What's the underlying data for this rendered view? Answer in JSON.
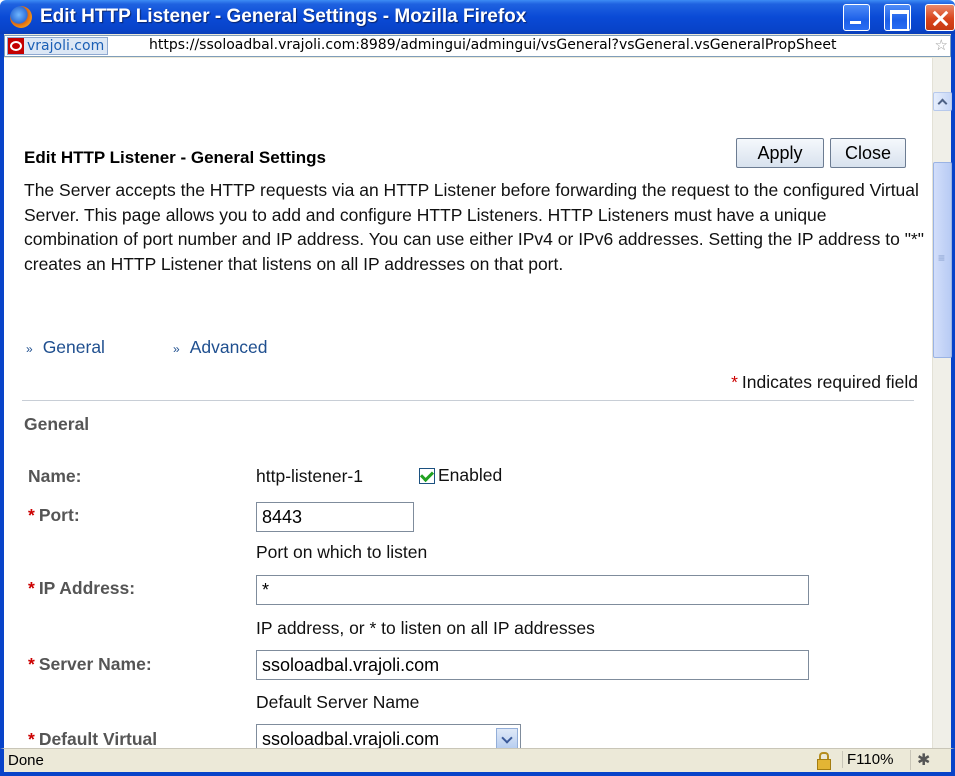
{
  "window": {
    "title": "Edit HTTP Listener - General Settings - Mozilla Firefox"
  },
  "urlbar": {
    "site_name": "vrajoli.com",
    "url": "https://ssoloadbal.vrajoli.com:8989/admingui/admingui/vsGeneral?vsGeneral.vsGeneralPropSheet"
  },
  "page": {
    "title": "Edit HTTP Listener - General Settings",
    "apply_label": "Apply",
    "close_label": "Close",
    "description": "The Server accepts the HTTP requests via an HTTP Listener before forwarding the request to the configured Virtual Server. This page allows you to add and configure HTTP Listeners. HTTP Listeners must have a unique combination of port number and IP address. You can use either IPv4 or IPv6 addresses. Setting the IP address to \"*\" creates an HTTP Listener that listens on all IP addresses on that port.",
    "jump_links": [
      "General",
      "Advanced"
    ],
    "required_star": "*",
    "required_note": "Indicates required field",
    "section_title": "General"
  },
  "form": {
    "name_label": "Name:",
    "name_value": "http-listener-1",
    "enabled_label": "Enabled",
    "enabled_checked": true,
    "port_label": "Port:",
    "port_value": "8443",
    "port_help": "Port on which to listen",
    "ip_label": "IP Address:",
    "ip_value": "*",
    "ip_help": "IP address, or * to listen on all IP addresses",
    "server_name_label": "Server Name:",
    "server_name_value": "ssoloadbal.vrajoli.com",
    "server_name_help": "Default Server Name",
    "default_virtual_label": "Default Virtual",
    "default_virtual_value": "ssoloadbal.vrajoli.com"
  },
  "statusbar": {
    "status": "Done",
    "zoom": "F110%"
  },
  "colors": {
    "titlebar": "#0a4ad6",
    "link": "#1f4f8f",
    "required": "#cc0000",
    "label": "#555555"
  }
}
